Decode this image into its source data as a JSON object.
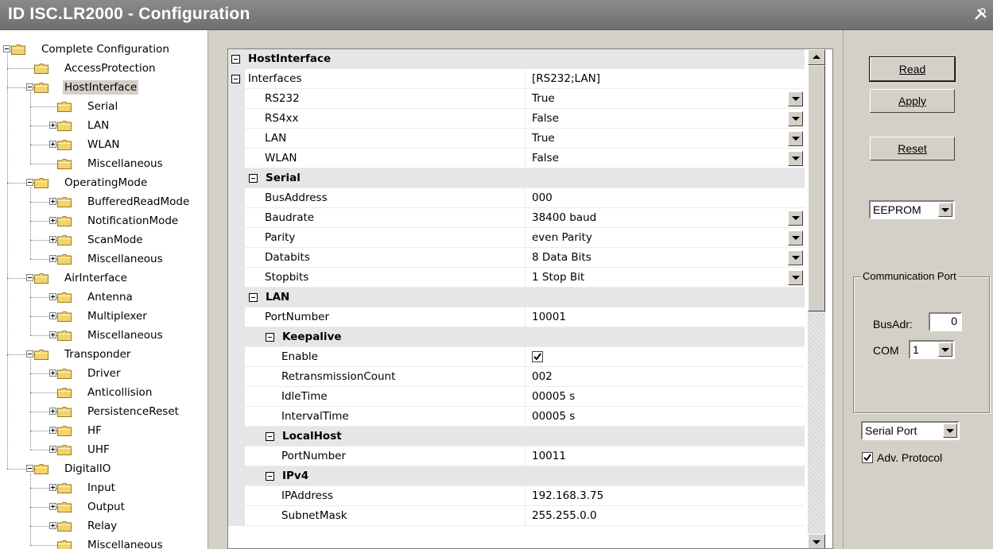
{
  "window": {
    "title": "ID ISC.LR2000 - Configuration"
  },
  "tree": [
    {
      "label": "Complete Configuration",
      "level": 0,
      "expander": "minus"
    },
    {
      "label": "AccessProtection",
      "level": 1,
      "expander": "none"
    },
    {
      "label": "HostInterface",
      "level": 1,
      "expander": "minus",
      "selected": true
    },
    {
      "label": "Serial",
      "level": 2,
      "expander": "none"
    },
    {
      "label": "LAN",
      "level": 2,
      "expander": "plus"
    },
    {
      "label": "WLAN",
      "level": 2,
      "expander": "plus"
    },
    {
      "label": "Miscellaneous",
      "level": 2,
      "expander": "none"
    },
    {
      "label": "OperatingMode",
      "level": 1,
      "expander": "minus"
    },
    {
      "label": "BufferedReadMode",
      "level": 2,
      "expander": "plus"
    },
    {
      "label": "NotificationMode",
      "level": 2,
      "expander": "plus"
    },
    {
      "label": "ScanMode",
      "level": 2,
      "expander": "plus"
    },
    {
      "label": "Miscellaneous",
      "level": 2,
      "expander": "plus"
    },
    {
      "label": "AirInterface",
      "level": 1,
      "expander": "minus"
    },
    {
      "label": "Antenna",
      "level": 2,
      "expander": "plus"
    },
    {
      "label": "Multiplexer",
      "level": 2,
      "expander": "plus"
    },
    {
      "label": "Miscellaneous",
      "level": 2,
      "expander": "plus"
    },
    {
      "label": "Transponder",
      "level": 1,
      "expander": "minus"
    },
    {
      "label": "Driver",
      "level": 2,
      "expander": "plus"
    },
    {
      "label": "Anticollision",
      "level": 2,
      "expander": "none"
    },
    {
      "label": "PersistenceReset",
      "level": 2,
      "expander": "plus"
    },
    {
      "label": "HF",
      "level": 2,
      "expander": "plus"
    },
    {
      "label": "UHF",
      "level": 2,
      "expander": "plus"
    },
    {
      "label": "DigitalIO",
      "level": 1,
      "expander": "minus"
    },
    {
      "label": "Input",
      "level": 2,
      "expander": "plus"
    },
    {
      "label": "Output",
      "level": 2,
      "expander": "plus"
    },
    {
      "label": "Relay",
      "level": 2,
      "expander": "plus"
    },
    {
      "label": "Miscellaneous",
      "level": 2,
      "expander": "none"
    }
  ],
  "grid": [
    {
      "type": "category",
      "name": "HostInterface",
      "depth": 0
    },
    {
      "type": "group",
      "name": "Interfaces",
      "depth": 0,
      "value": "[RS232;LAN]"
    },
    {
      "type": "prop",
      "name": "RS232",
      "depth": 1,
      "value": "True",
      "dropdown": true
    },
    {
      "type": "prop",
      "name": "RS4xx",
      "depth": 1,
      "value": "False",
      "dropdown": true
    },
    {
      "type": "prop",
      "name": "LAN",
      "depth": 1,
      "value": "True",
      "dropdown": true
    },
    {
      "type": "prop",
      "name": "WLAN",
      "depth": 1,
      "value": "False",
      "dropdown": true
    },
    {
      "type": "category",
      "name": "Serial",
      "depth": 1
    },
    {
      "type": "prop",
      "name": "BusAddress",
      "depth": 1,
      "value": "000"
    },
    {
      "type": "prop",
      "name": "Baudrate",
      "depth": 1,
      "value": "38400 baud",
      "dropdown": true
    },
    {
      "type": "prop",
      "name": "Parity",
      "depth": 1,
      "value": "even Parity",
      "dropdown": true
    },
    {
      "type": "prop",
      "name": "Databits",
      "depth": 1,
      "value": "8 Data Bits",
      "dropdown": true
    },
    {
      "type": "prop",
      "name": "Stopbits",
      "depth": 1,
      "value": "1 Stop Bit",
      "dropdown": true
    },
    {
      "type": "category",
      "name": "LAN",
      "depth": 1
    },
    {
      "type": "prop",
      "name": "PortNumber",
      "depth": 1,
      "value": "10001"
    },
    {
      "type": "category",
      "name": "Keepalive",
      "depth": 2
    },
    {
      "type": "prop",
      "name": "Enable",
      "depth": 2,
      "checkbox": true
    },
    {
      "type": "prop",
      "name": "RetransmissionCount",
      "depth": 2,
      "value": "002"
    },
    {
      "type": "prop",
      "name": "IdleTime",
      "depth": 2,
      "value": "00005 s"
    },
    {
      "type": "prop",
      "name": "IntervalTime",
      "depth": 2,
      "value": "00005 s"
    },
    {
      "type": "category",
      "name": "LocalHost",
      "depth": 2
    },
    {
      "type": "prop",
      "name": "PortNumber",
      "depth": 2,
      "value": "10011"
    },
    {
      "type": "category",
      "name": "IPv4",
      "depth": 2
    },
    {
      "type": "prop",
      "name": "IPAddress",
      "depth": 2,
      "value": "192.168.3.75"
    },
    {
      "type": "prop",
      "name": "SubnetMask",
      "depth": 2,
      "value": "255.255.0.0"
    }
  ],
  "controls": {
    "read_label": "Read",
    "apply_label": "Apply",
    "reset_label": "Reset",
    "memory_select": "EEPROM",
    "comm_group_title": "Communication Port",
    "busadr_label": "BusAdr:",
    "busadr_value": "0",
    "com_label": "COM",
    "com_value": "1",
    "port_select": "Serial Port",
    "adv_protocol_label": "Adv. Protocol",
    "adv_protocol_checked": true
  },
  "colors": {
    "folder": "#f3d36b",
    "selection": "#d4d0c8",
    "titlebar": "#7a7a7a"
  }
}
